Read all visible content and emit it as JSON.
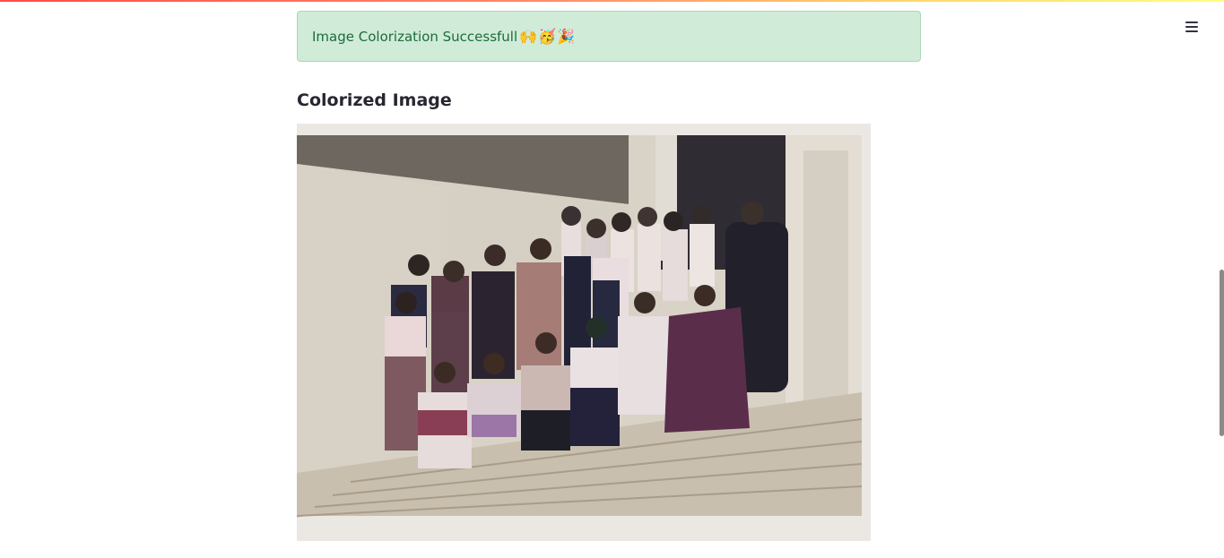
{
  "alert": {
    "message": "Image Colorization Successfull",
    "emojis": "🙌🥳🎉"
  },
  "section": {
    "title": "Colorized Image"
  },
  "image": {
    "subject": "colorized group photo"
  },
  "colors": {
    "alert_bg": "#d0ecd8",
    "alert_text": "#1d6b3b",
    "title_text": "#262730"
  },
  "icons": {
    "menu": "hamburger-icon"
  }
}
